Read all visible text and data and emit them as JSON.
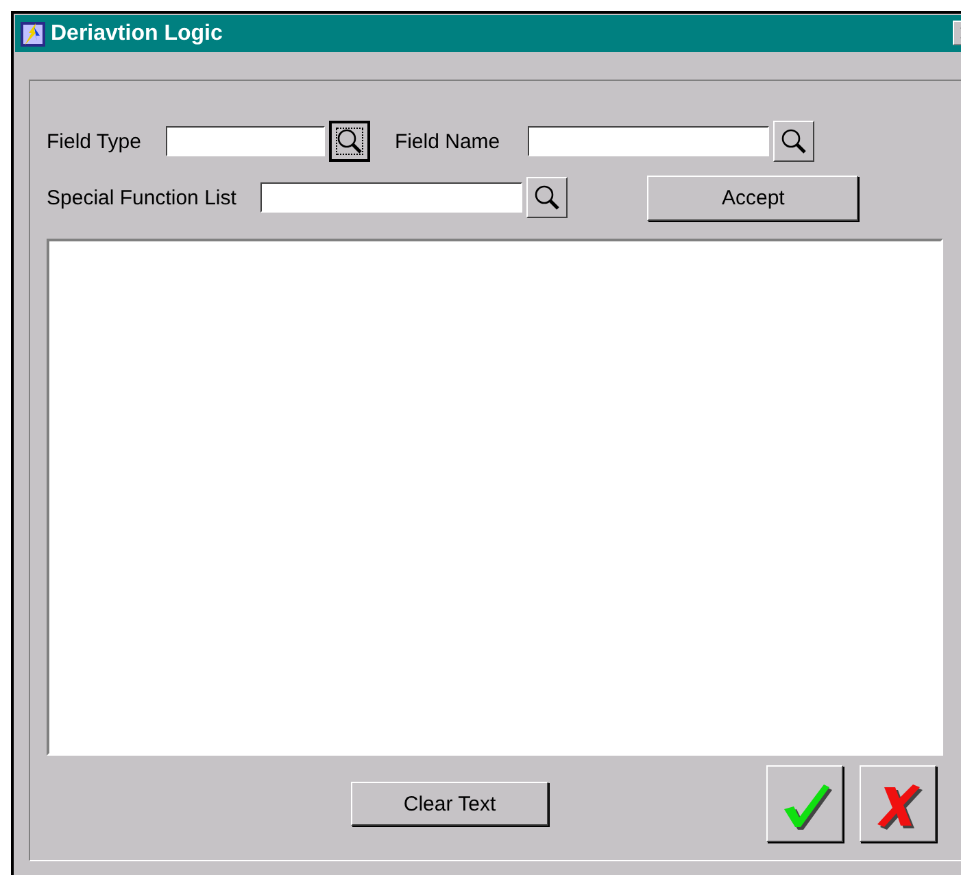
{
  "window": {
    "title": "Deriavtion Logic"
  },
  "fields": [
    {
      "label": "Field Type",
      "lookup_focused": true
    },
    {
      "label": "Field Name",
      "lookup_focused": false
    },
    {
      "label": "Special Function List",
      "lookup_focused": false
    }
  ],
  "accept_button": "Accept",
  "clear_button": "Clear Text"
}
